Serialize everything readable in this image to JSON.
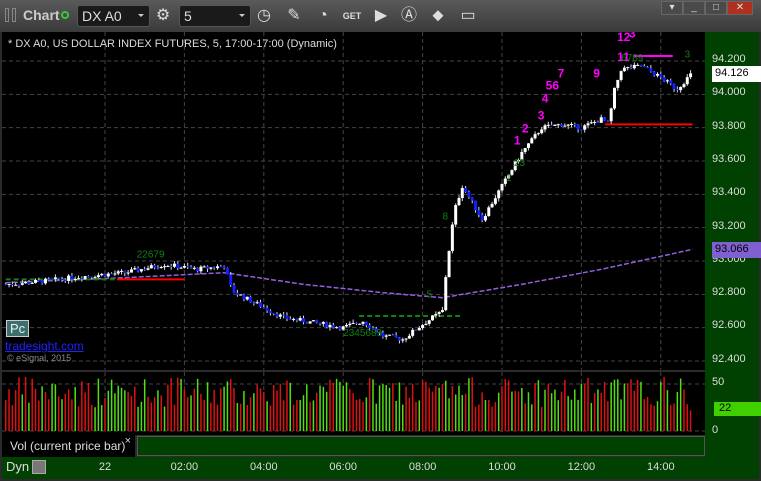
{
  "window": {
    "title": "Chart",
    "symbol": "DX A0",
    "interval": "5",
    "controls": [
      "minimize",
      "maximize",
      "close"
    ]
  },
  "toolbar": {
    "icons": [
      "gear-icon",
      "clock-icon",
      "pencil-icon",
      "study-icon",
      "get-icon",
      "play-icon",
      "alert-icon",
      "link-icon",
      "comment-icon"
    ]
  },
  "legend": "* DX A0, US DOLLAR INDEX FUTURES, 5, 17:00-17:00 (Dynamic)",
  "watermark": {
    "badge": "Pc",
    "site": "tradesight.com",
    "copyright": "© eSignal, 2015"
  },
  "price_axis": {
    "labels": [
      "94.200",
      "94.000",
      "93.800",
      "93.600",
      "93.400",
      "93.200",
      "93.000",
      "92.800",
      "92.600",
      "92.400"
    ],
    "last_price": "94.126",
    "ma_value": "93.066"
  },
  "volume_axis": {
    "labels": [
      "50",
      "0"
    ],
    "last_volume": "22"
  },
  "volume_study_label": "Vol (current price bar)",
  "volume_close": "×",
  "time_axis": {
    "mode": "Dyn",
    "ticks": [
      "22",
      "02:00",
      "04:00",
      "06:00",
      "08:00",
      "10:00",
      "12:00",
      "14:00"
    ]
  },
  "colors": {
    "up": "#ffffff",
    "down": "#1020ff",
    "ma": "#9060e0",
    "vol_up": "#50e010",
    "vol_down": "#e01010",
    "td_magenta": "#ff00ff",
    "td_green": "#108010"
  },
  "chart_data": {
    "type": "candlestick",
    "x_unit": "hours from 22 00:00",
    "xlim": [
      -2.55,
      14.95
    ],
    "ylim": [
      92.35,
      94.4
    ],
    "price_path": [
      [
        -2.5,
        92.86
      ],
      [
        -1.5,
        92.88
      ],
      [
        -0.5,
        92.91
      ],
      [
        0.5,
        92.93
      ],
      [
        1.5,
        92.98
      ],
      [
        2.3,
        92.95
      ],
      [
        3.0,
        92.97
      ],
      [
        3.2,
        92.82
      ],
      [
        4.0,
        92.72
      ],
      [
        4.5,
        92.66
      ],
      [
        5.5,
        92.62
      ],
      [
        6.0,
        92.6
      ],
      [
        6.5,
        92.64
      ],
      [
        7.0,
        92.55
      ],
      [
        7.5,
        92.53
      ],
      [
        8.0,
        92.62
      ],
      [
        8.5,
        92.7
      ],
      [
        8.6,
        92.95
      ],
      [
        8.8,
        93.3
      ],
      [
        9.0,
        93.45
      ],
      [
        9.5,
        93.25
      ],
      [
        10.0,
        93.45
      ],
      [
        10.5,
        93.65
      ],
      [
        11.0,
        93.8
      ],
      [
        11.5,
        93.82
      ],
      [
        12.0,
        93.8
      ],
      [
        12.5,
        93.85
      ],
      [
        12.7,
        93.82
      ],
      [
        12.8,
        94.0
      ],
      [
        13.0,
        94.15
      ],
      [
        13.5,
        94.17
      ],
      [
        14.0,
        94.1
      ],
      [
        14.4,
        94.03
      ],
      [
        14.8,
        94.13
      ]
    ],
    "moving_average": [
      [
        -2.5,
        92.87
      ],
      [
        0.5,
        92.9
      ],
      [
        3.0,
        92.93
      ],
      [
        5.0,
        92.86
      ],
      [
        7.0,
        92.81
      ],
      [
        8.5,
        92.78
      ],
      [
        10.5,
        92.86
      ],
      [
        12.5,
        92.95
      ],
      [
        14.8,
        93.07
      ]
    ],
    "levels": [
      {
        "price": 93.82,
        "from": 12.6,
        "to": 14.8,
        "color": "#ff0000"
      },
      {
        "price": 94.23,
        "from": 13.3,
        "to": 14.3,
        "color": "#ff00ff"
      },
      {
        "price": 92.67,
        "from": 6.4,
        "to": 9.0,
        "color": "#108010",
        "dashed": true
      },
      {
        "price": 92.89,
        "from": -2.5,
        "to": 0.3,
        "color": "#108010",
        "dashed": true
      },
      {
        "price": 92.89,
        "from": 0.3,
        "to": 2.0,
        "color": "#ff0000"
      }
    ],
    "td_counts": [
      {
        "t": 10.3,
        "p": 93.7,
        "text": "1",
        "c": "m"
      },
      {
        "t": 10.5,
        "p": 93.77,
        "text": "2",
        "c": "m"
      },
      {
        "t": 10.9,
        "p": 93.85,
        "text": "3",
        "c": "m"
      },
      {
        "t": 11.0,
        "p": 93.95,
        "text": "4",
        "c": "m"
      },
      {
        "t": 11.1,
        "p": 94.03,
        "text": "56",
        "c": "m"
      },
      {
        "t": 11.4,
        "p": 94.1,
        "text": "7",
        "c": "m"
      },
      {
        "t": 12.3,
        "p": 94.1,
        "text": "9",
        "c": "m"
      },
      {
        "t": 12.9,
        "p": 94.2,
        "text": "11",
        "c": "m"
      },
      {
        "t": 12.9,
        "p": 94.32,
        "text": "12",
        "c": "m"
      },
      {
        "t": 13.2,
        "p": 94.34,
        "text": "3",
        "c": "m"
      },
      {
        "t": 8.5,
        "p": 93.25,
        "text": "8",
        "c": "g"
      },
      {
        "t": 10.1,
        "p": 93.48,
        "text": "1",
        "c": "g"
      },
      {
        "t": 10.3,
        "p": 93.57,
        "text": "23",
        "c": "g"
      },
      {
        "t": 13.0,
        "p": 94.2,
        "text": "6789",
        "c": "g"
      },
      {
        "t": 14.6,
        "p": 94.22,
        "text": "3",
        "c": "g"
      },
      {
        "t": 0.8,
        "p": 93.02,
        "text": "22679",
        "c": "g"
      },
      {
        "t": 6.0,
        "p": 92.55,
        "text": "2345689",
        "c": "g"
      },
      {
        "t": 8.1,
        "p": 92.78,
        "text": "5",
        "c": "g"
      }
    ]
  }
}
